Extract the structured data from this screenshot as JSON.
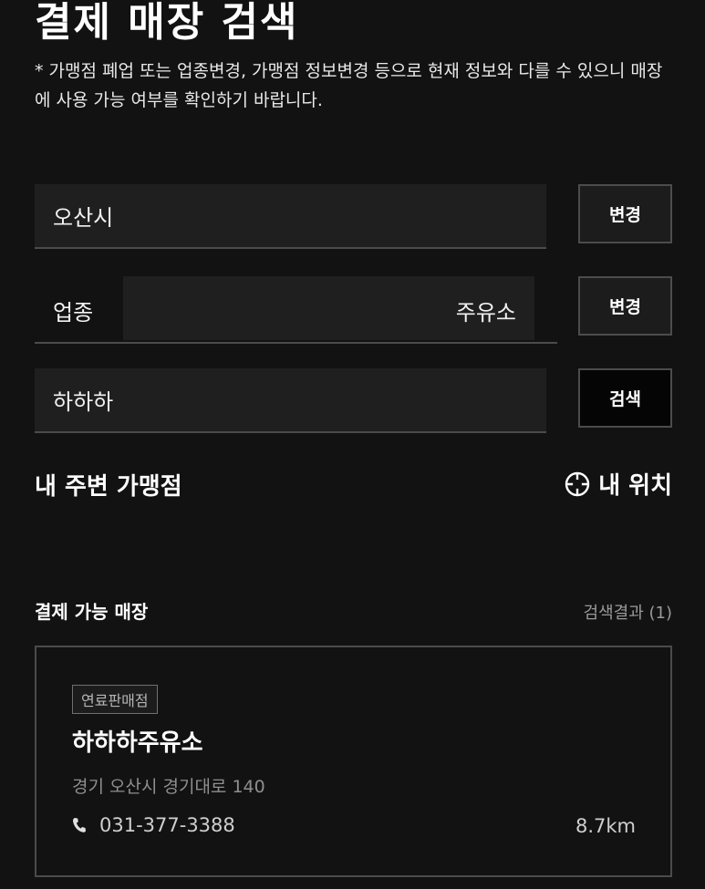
{
  "header": {
    "title": "결제 매장 검색",
    "notice": "* 가맹점 폐업 또는 업종변경, 가맹점 정보변경 등으로 현재 정보와 다를 수 있으니 매장에 사용 가능 여부를 확인하기 바랍니다."
  },
  "search": {
    "region_value": "오산시",
    "region_button": "변경",
    "business_label": "업종",
    "business_value": "주유소",
    "business_button": "변경",
    "keyword_value": "하하하",
    "search_button": "검색"
  },
  "nearby": {
    "title": "내 주변 가맹점",
    "my_location_label": "내 위치",
    "icon": "crosshair-icon"
  },
  "results": {
    "title": "결제 가능 매장",
    "count_label": "검색결과 (1)",
    "stores": [
      {
        "badge": "연료판매점",
        "name": "하하하주유소",
        "address": "경기 오산시 경기대로 140",
        "phone": "031-377-3388",
        "distance": "8.7km"
      }
    ]
  },
  "colors": {
    "background": "#121212",
    "field": "#1f1f1f",
    "border": "#4b4b4b",
    "text": "#ffffff",
    "muted": "#8f8f8f"
  }
}
